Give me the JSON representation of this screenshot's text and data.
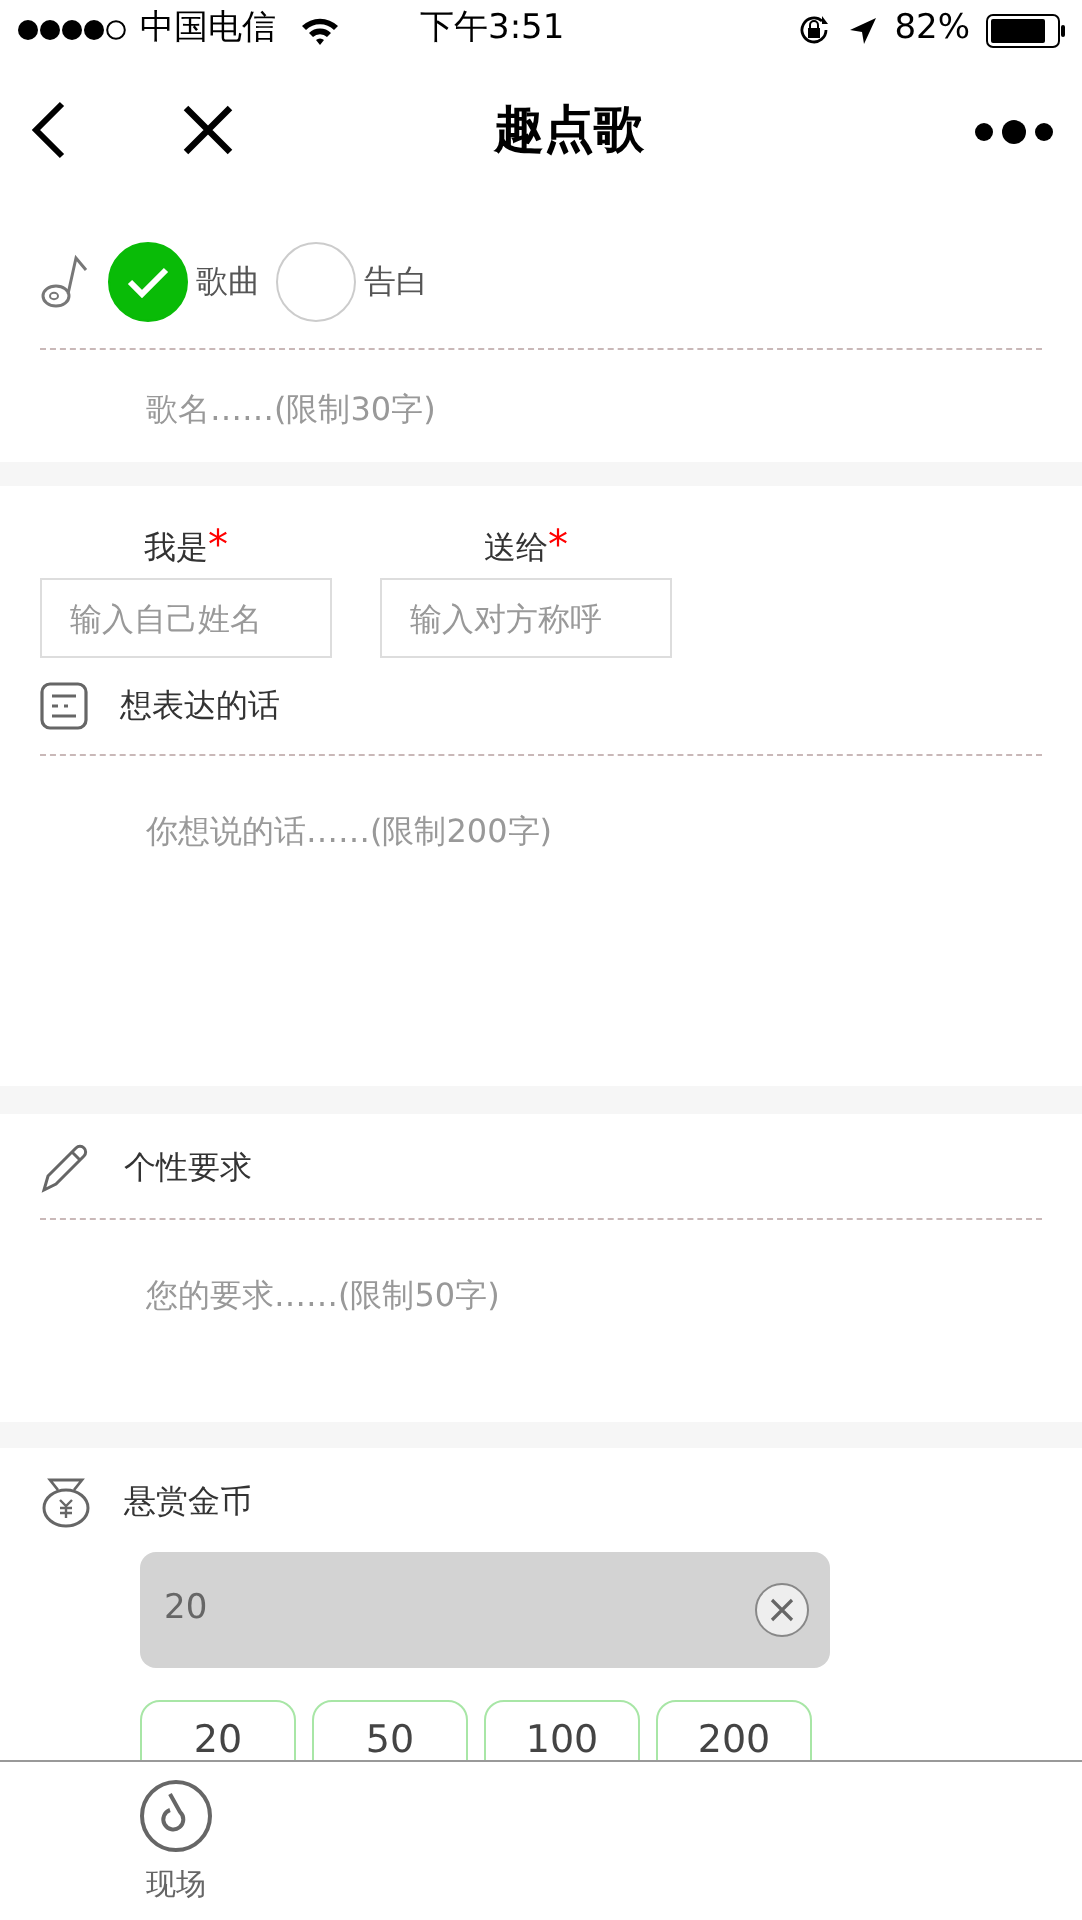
{
  "status_bar": {
    "carrier": "中国电信",
    "time": "下午3:51",
    "battery": "82%"
  },
  "nav": {
    "title": "趣点歌"
  },
  "type_options": [
    {
      "label": "歌曲",
      "selected": true
    },
    {
      "label": "告白",
      "selected": false
    }
  ],
  "song_name": {
    "placeholder": "歌名……(限制30字)"
  },
  "names": [
    {
      "label": "我是",
      "required_mark": "*",
      "placeholder": "输入自己姓名"
    },
    {
      "label": "送给",
      "required_mark": "*",
      "placeholder": "输入对方称呼"
    }
  ],
  "message": {
    "label": "想表达的话",
    "placeholder": "你想说的话……(限制200字)"
  },
  "requirements": {
    "label": "个性要求",
    "placeholder": "您的要求……(限制50字)"
  },
  "reward": {
    "label": "悬赏金币",
    "value": "20",
    "amounts": [
      {
        "label": "20"
      },
      {
        "label": "50"
      },
      {
        "label": "100"
      },
      {
        "label": "200"
      }
    ]
  },
  "tab_bar": [
    {
      "label": "现场"
    }
  ]
}
